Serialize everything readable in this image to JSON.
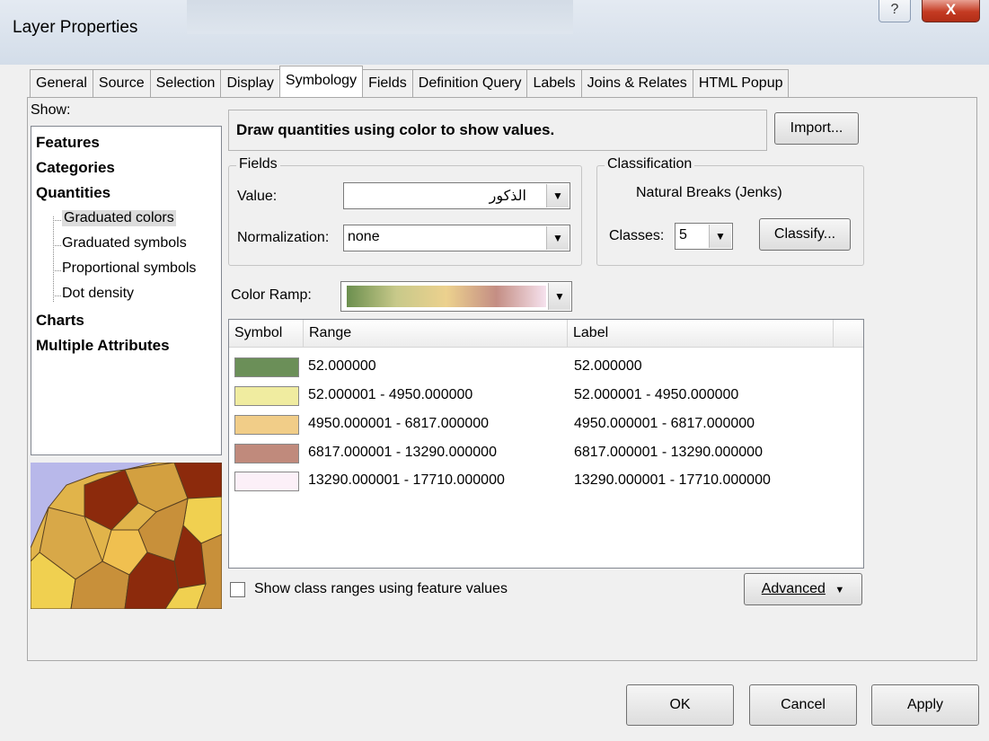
{
  "window": {
    "title": "Layer Properties",
    "help_glyph": "?",
    "close_glyph": "X"
  },
  "tabs": [
    {
      "label": "General",
      "active": false
    },
    {
      "label": "Source",
      "active": false
    },
    {
      "label": "Selection",
      "active": false
    },
    {
      "label": "Display",
      "active": false
    },
    {
      "label": "Symbology",
      "active": true
    },
    {
      "label": "Fields",
      "active": false
    },
    {
      "label": "Definition Query",
      "active": false
    },
    {
      "label": "Labels",
      "active": false
    },
    {
      "label": "Joins & Relates",
      "active": false
    },
    {
      "label": "HTML Popup",
      "active": false
    }
  ],
  "show": {
    "label": "Show:",
    "items": [
      {
        "label": "Features"
      },
      {
        "label": "Categories"
      },
      {
        "label": "Quantities"
      },
      {
        "label": "Graduated colors",
        "selected": true
      },
      {
        "label": "Graduated symbols"
      },
      {
        "label": "Proportional symbols"
      },
      {
        "label": "Dot density"
      },
      {
        "label": "Charts"
      },
      {
        "label": "Multiple Attributes"
      }
    ]
  },
  "description": "Draw quantities using color to show values.",
  "import_button": "Import...",
  "fields": {
    "title": "Fields",
    "value_label": "Value:",
    "value": "الذكور",
    "normalization_label": "Normalization:",
    "normalization": "none"
  },
  "classification": {
    "title": "Classification",
    "method": "Natural Breaks (Jenks)",
    "classes_label": "Classes:",
    "classes": "5",
    "classify_button": "Classify..."
  },
  "color_ramp": {
    "label": "Color Ramp:",
    "colors": [
      "#6b8f4e",
      "#c8c98a",
      "#ecd18e",
      "#c48e84",
      "#f6e2ee"
    ]
  },
  "table": {
    "headers": {
      "symbol": "Symbol",
      "range": "Range",
      "label": "Label"
    },
    "rows": [
      {
        "color": "#6b8f58",
        "range": "52.000000",
        "label": "52.000000"
      },
      {
        "color": "#f0eca0",
        "range": "52.000001 - 4950.000000",
        "label": "52.000001 - 4950.000000"
      },
      {
        "color": "#f1cd88",
        "range": "4950.000001 - 6817.000000",
        "label": "4950.000001 - 6817.000000"
      },
      {
        "color": "#c08a7c",
        "range": "6817.000001 - 13290.000000",
        "label": "6817.000001 - 13290.000000"
      },
      {
        "color": "#fcf0f8",
        "range": "13290.000001 - 17710.000000",
        "label": "13290.000001 - 17710.000000"
      }
    ]
  },
  "show_class_ranges": {
    "label": "Show class ranges using feature values",
    "checked": false
  },
  "advanced_button": "Advanced",
  "footer": {
    "ok": "OK",
    "cancel": "Cancel",
    "apply": "Apply"
  }
}
